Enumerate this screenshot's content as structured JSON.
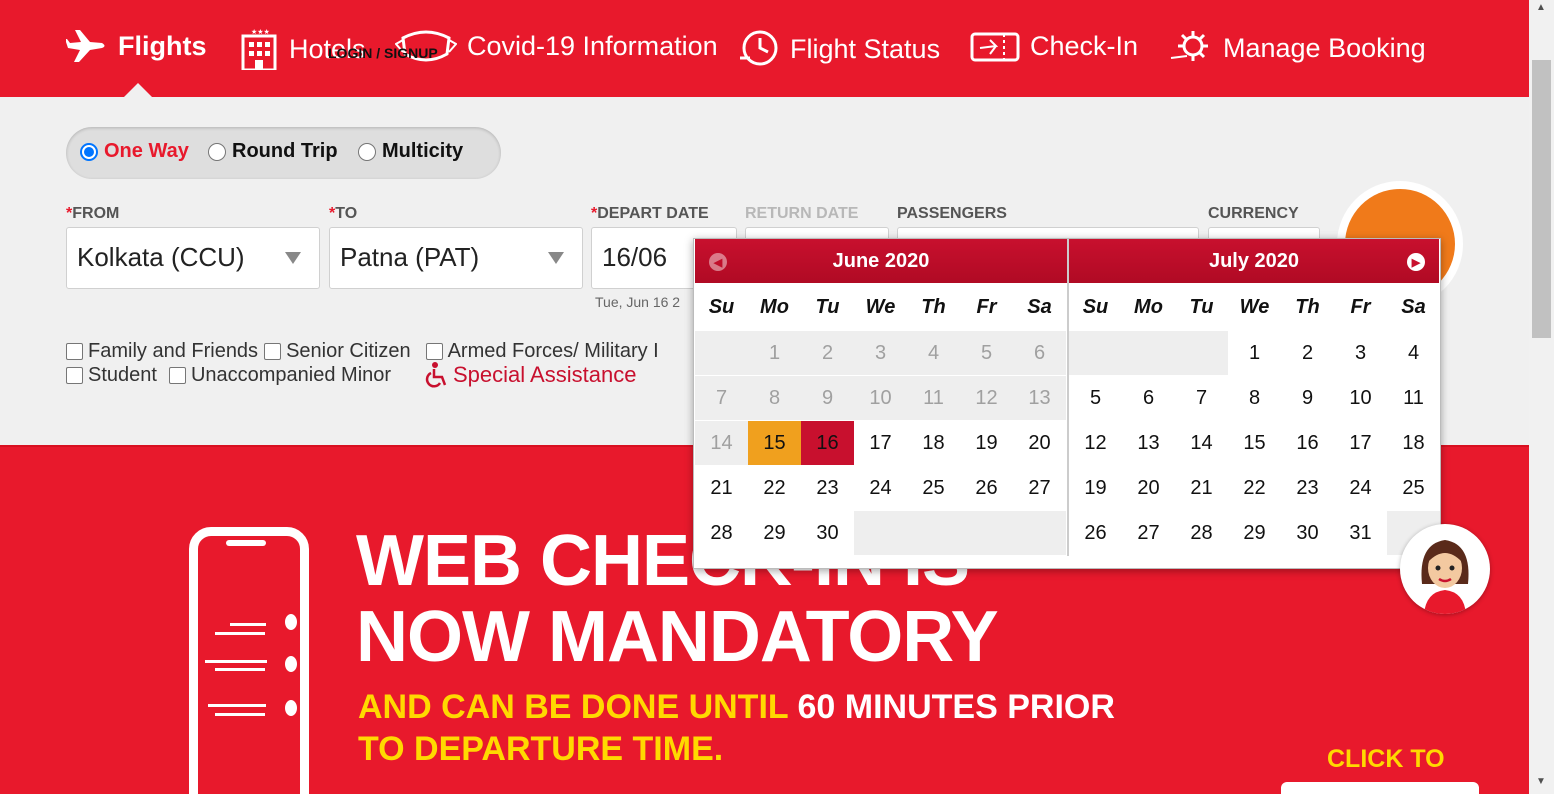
{
  "nav": {
    "items": [
      {
        "label": "Flights",
        "icon": "plane-icon"
      },
      {
        "label": "Hotels",
        "icon": "hotel-icon"
      },
      {
        "label": "Covid-19 Information",
        "icon": "mask-icon"
      },
      {
        "label": "Flight Status",
        "icon": "clock-plane-icon"
      },
      {
        "label": "Check-In",
        "icon": "ticket-icon"
      },
      {
        "label": "Manage Booking",
        "icon": "gear-plane-icon"
      }
    ],
    "login": "LOGIN / SIGNUP"
  },
  "trip_type": {
    "options": [
      "One Way",
      "Round Trip",
      "Multicity"
    ],
    "selected": "One Way"
  },
  "form": {
    "from_label": "FROM",
    "from_value": "Kolkata (CCU)",
    "to_label": "TO",
    "to_value": "Patna (PAT)",
    "depart_label": "DEPART DATE",
    "depart_value": "16/06",
    "depart_sub": "Tue, Jun 16 2",
    "return_label": "RETURN DATE",
    "passengers_label": "PASSENGERS",
    "currency_label": "CURRENCY",
    "required_mark": "*"
  },
  "checkboxes": {
    "row1": [
      "Family and Friends",
      "Senior Citizen",
      "Armed Forces/ Military I"
    ],
    "row2": [
      "Student",
      "Unaccompanied Minor"
    ],
    "special": "Special Assistance"
  },
  "calendar": {
    "weekdays": [
      "Su",
      "Mo",
      "Tu",
      "We",
      "Th",
      "Fr",
      "Sa"
    ],
    "months": [
      {
        "title": "June 2020",
        "offset": 1,
        "days": 30,
        "past_until": 14,
        "today": 15,
        "selected": 16
      },
      {
        "title": "July 2020",
        "offset": 3,
        "days": 31,
        "past_until": 0,
        "today": 0,
        "selected": 0
      }
    ]
  },
  "banner": {
    "line1": "WEB CHECK-IN IS",
    "line2": "NOW MANDATORY",
    "sub1_yellow": "AND CAN BE DONE UNTIL",
    "sub1_white": "60 MINUTES PRIOR",
    "sub2": "TO DEPARTURE TIME.",
    "cta": "CLICK TO"
  },
  "colors": {
    "brand_red": "#e8192c",
    "today": "#f0a01e",
    "selected": "#c8102e",
    "accent_yellow": "#ffd900"
  }
}
